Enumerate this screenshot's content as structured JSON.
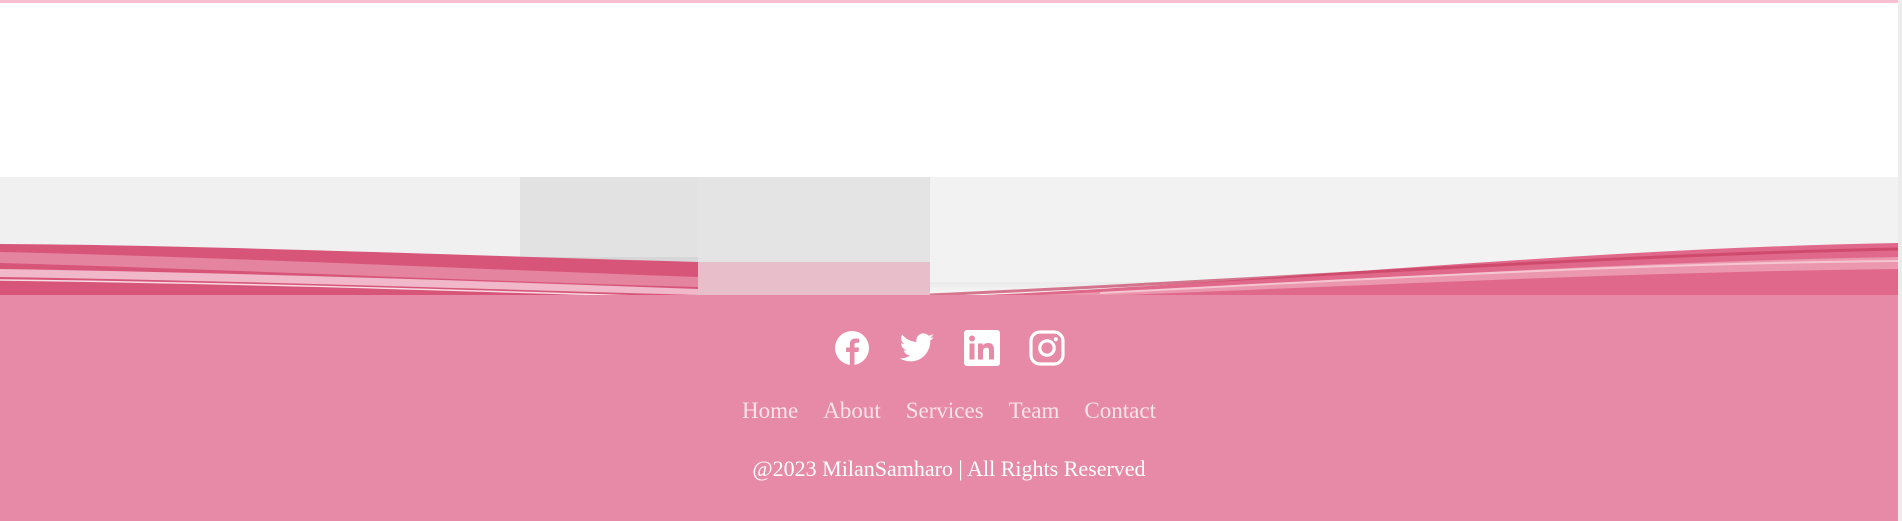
{
  "footer": {
    "social": [
      {
        "name": "facebook",
        "icon": "facebook-icon"
      },
      {
        "name": "twitter",
        "icon": "twitter-icon"
      },
      {
        "name": "linkedin",
        "icon": "linkedin-icon"
      },
      {
        "name": "instagram",
        "icon": "instagram-icon"
      }
    ],
    "nav": [
      {
        "label": "Home"
      },
      {
        "label": "About"
      },
      {
        "label": "Services"
      },
      {
        "label": "Team"
      },
      {
        "label": "Contact"
      }
    ],
    "copyright": "@2023 MilanSamharo | All Rights Reserved"
  },
  "colors": {
    "footer_bg": "#e68aa8",
    "accent_pink": "#d9456f",
    "nav_text": "#fbe3ea",
    "top_line": "#f7bfcf"
  }
}
